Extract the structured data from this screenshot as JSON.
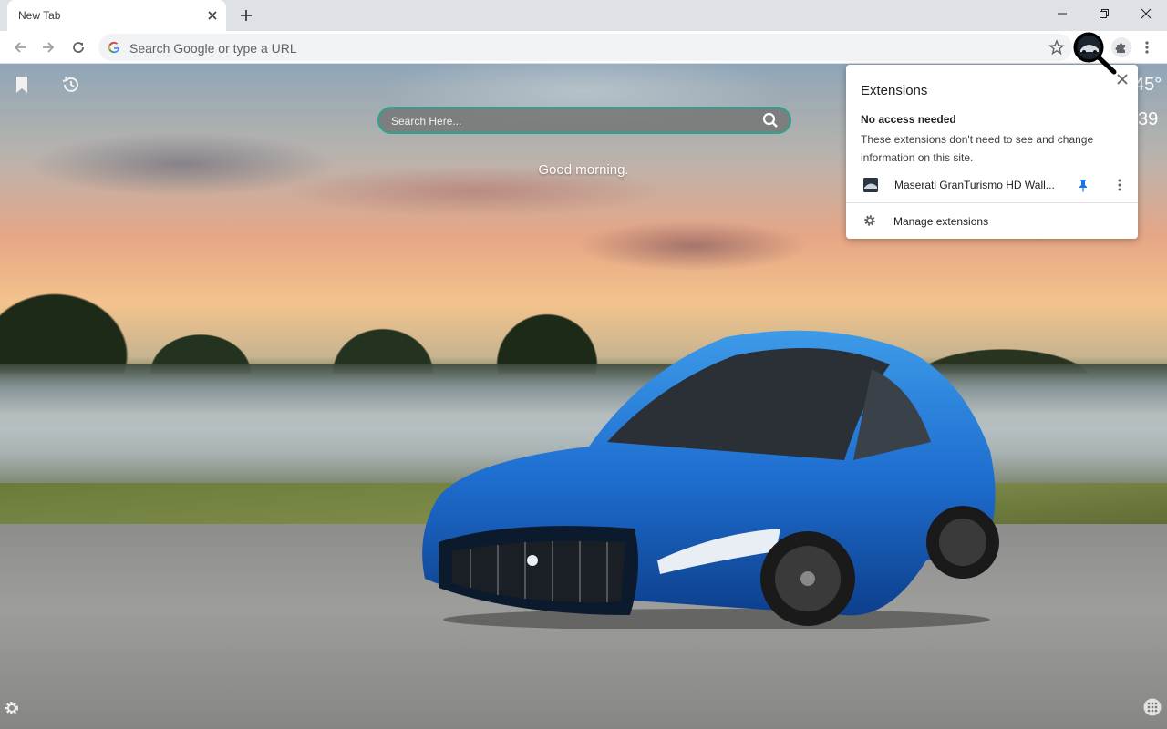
{
  "browser": {
    "tab": {
      "title": "New Tab"
    },
    "omnibox": {
      "placeholder": "Search Google or type a URL"
    }
  },
  "newtab": {
    "search": {
      "placeholder": "Search Here..."
    },
    "greeting": "Good morning.",
    "weather": {
      "temp": "45°",
      "value": "39"
    }
  },
  "extensions_popup": {
    "title": "Extensions",
    "heading": "No access needed",
    "description": "These extensions don't need to see and change information on this site.",
    "items": [
      {
        "name": "Maserati GranTurismo HD Wall...",
        "pinned": true
      }
    ],
    "manage_label": "Manage extensions"
  },
  "colors": {
    "accent_teal": "#2aa58f",
    "pin_blue": "#1a73e8",
    "car_blue": "#1f6fd1"
  }
}
